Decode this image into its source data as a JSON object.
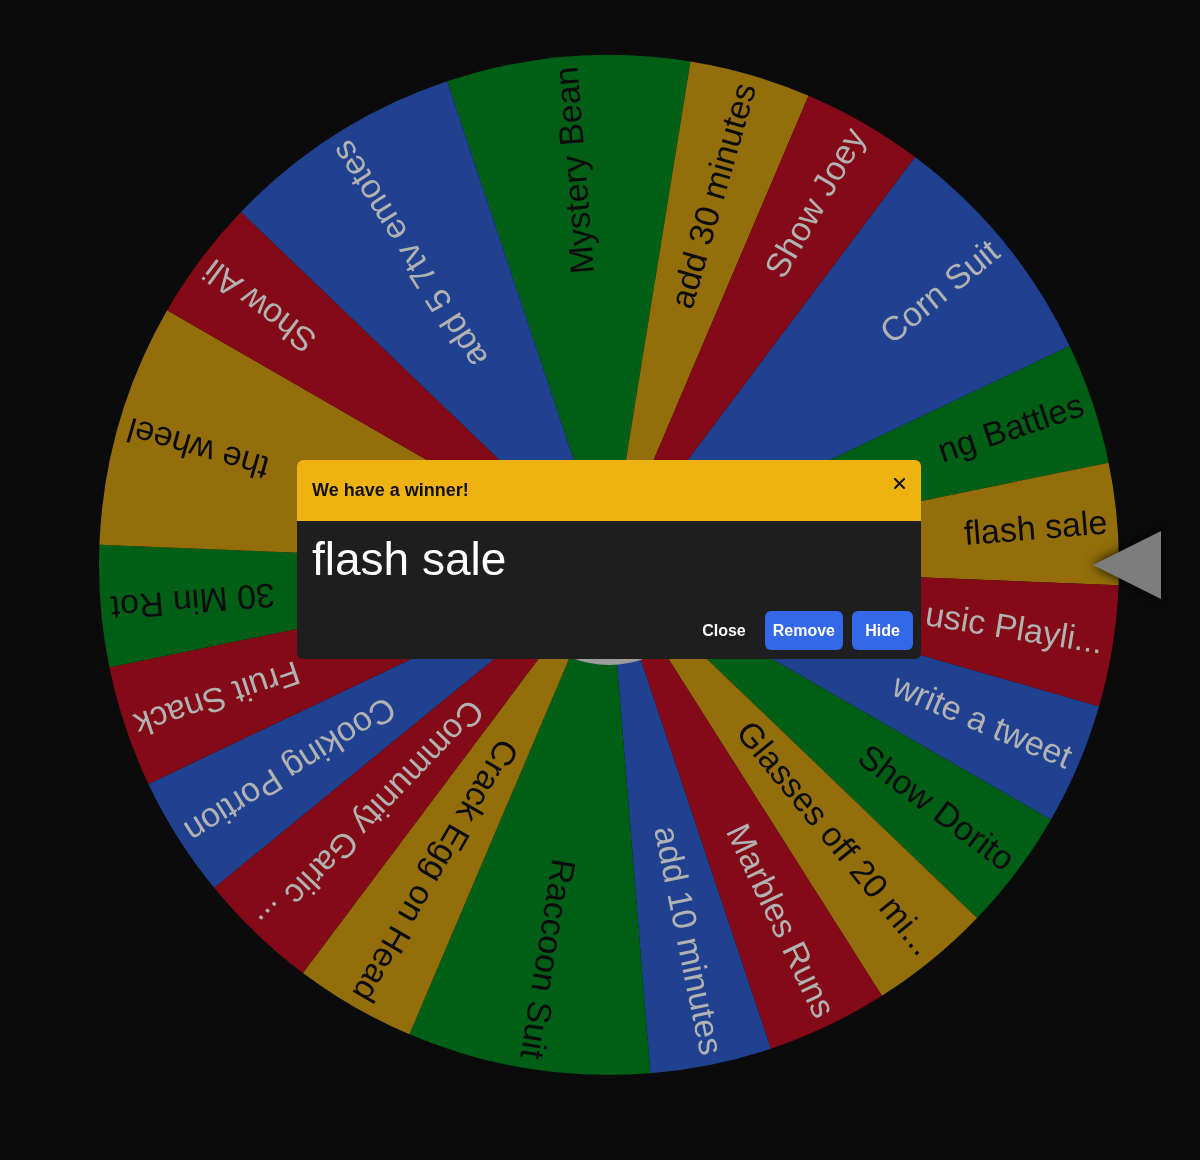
{
  "wheel": {
    "segments": [
      {
        "label": "Mystery Bean",
        "color": "#005f17",
        "kind": "wide"
      },
      {
        "label": "add 30 minutes",
        "color": "#936e0b",
        "kind": "normal"
      },
      {
        "label": "Show Joey",
        "color": "#840a17",
        "kind": "normal"
      },
      {
        "label": "Corn Suit",
        "color": "#20418f",
        "kind": "wide"
      },
      {
        "label": "ng Battles",
        "color": "#005f17",
        "kind": "normal"
      },
      {
        "label": "flash sale",
        "color": "#936e0b",
        "kind": "normal"
      },
      {
        "label": "usic Playli...",
        "color": "#840a17",
        "kind": "normal"
      },
      {
        "label": "write a tweet",
        "color": "#20418f",
        "kind": "normal"
      },
      {
        "label": "Show Dorito",
        "color": "#005f17",
        "kind": "normal"
      },
      {
        "label": "Glasses off 20 mi...",
        "color": "#936e0b",
        "kind": "normal"
      },
      {
        "label": "Marbles Runs",
        "color": "#840a17",
        "kind": "normal"
      },
      {
        "label": "add 10 minutes",
        "color": "#20418f",
        "kind": "normal"
      },
      {
        "label": "Raccoon Suit",
        "color": "#005f17",
        "kind": "wide"
      },
      {
        "label": "Crack Egg on Head",
        "color": "#936e0b",
        "kind": "normal"
      },
      {
        "label": "Community Garlic ...",
        "color": "#840a17",
        "kind": "normal"
      },
      {
        "label": "Cooking Portion",
        "color": "#20418f",
        "kind": "normal"
      },
      {
        "label": "Fruit Snack",
        "color": "#840a17",
        "kind": "normal"
      },
      {
        "label": "30 Min Rot",
        "color": "#005f17",
        "kind": "normal"
      },
      {
        "label": "the wheel",
        "color": "#936e0b",
        "kind": "wide"
      },
      {
        "label": "Show Ali",
        "color": "#840a17",
        "kind": "normal"
      },
      {
        "label": "add 5 7tv emotes",
        "color": "#20418f",
        "kind": "wide"
      }
    ]
  },
  "winner_dialog": {
    "title": "We have a winner!",
    "winner": "flash sale",
    "buttons": [
      {
        "label": "Close",
        "kind": "plain"
      },
      {
        "label": "Remove",
        "kind": "filled"
      },
      {
        "label": "Hide",
        "kind": "filled"
      }
    ]
  }
}
